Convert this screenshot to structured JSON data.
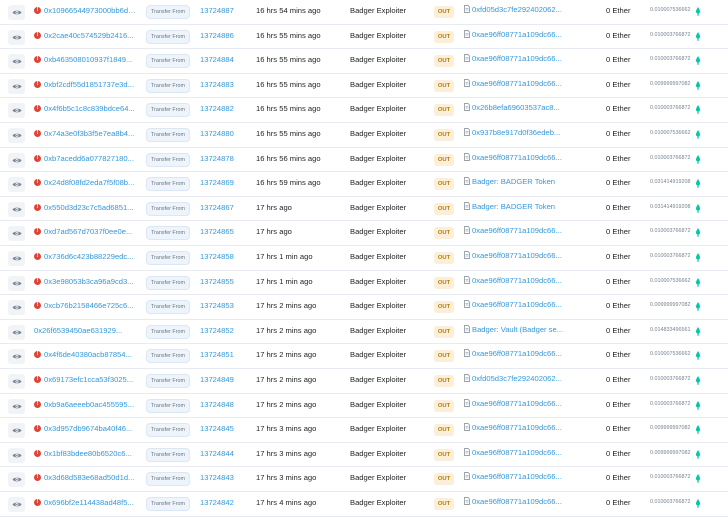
{
  "colors": {
    "link": "#3498db",
    "error": "#de4437",
    "out_bg": "#fcefd9",
    "out_text": "#b47d00",
    "gas_green": "#00c9a7"
  },
  "icons": {
    "view": "eye-icon",
    "error": "exclamation-circle-icon",
    "contract": "file-contract-icon",
    "gas": "gas-drop-icon"
  },
  "rows": [
    {
      "error": true,
      "hash": "0x10966544973000bb6d38...",
      "method": "Transfer From",
      "block": "13724887",
      "age": "16 hrs 54 mins ago",
      "from": "Badger Exploiter",
      "dir": "OUT",
      "to": "0xfd05d3c7fe292402062...",
      "to_contract": true,
      "value": "0 Ether",
      "fee": "0.010007536662"
    },
    {
      "error": true,
      "hash": "0x2cae40c574529b2416...",
      "method": "Transfer From",
      "block": "13724886",
      "age": "16 hrs 55 mins ago",
      "from": "Badger Exploiter",
      "dir": "OUT",
      "to": "0xae96ff08771a109dc66...",
      "to_contract": true,
      "value": "0 Ether",
      "fee": "0.010003766872"
    },
    {
      "error": true,
      "hash": "0xb463508010937f1849...",
      "method": "Transfer From",
      "block": "13724884",
      "age": "16 hrs 55 mins ago",
      "from": "Badger Exploiter",
      "dir": "OUT",
      "to": "0xae96ff08771a109dc66...",
      "to_contract": true,
      "value": "0 Ether",
      "fee": "0.010003766872"
    },
    {
      "error": true,
      "hash": "0xbf2cdf55d1851737e3d...",
      "method": "Transfer From",
      "block": "13724883",
      "age": "16 hrs 55 mins ago",
      "from": "Badger Exploiter",
      "dir": "OUT",
      "to": "0xae96ff08771a109dc66...",
      "to_contract": true,
      "value": "0 Ether",
      "fee": "0.009999997082"
    },
    {
      "error": true,
      "hash": "0x4f6b5c1c8c839bdce64...",
      "method": "Transfer From",
      "block": "13724882",
      "age": "16 hrs 55 mins ago",
      "from": "Badger Exploiter",
      "dir": "OUT",
      "to": "0x26b8efa69603537ac8...",
      "to_contract": true,
      "value": "0 Ether",
      "fee": "0.010003766872"
    },
    {
      "error": true,
      "hash": "0x74a3e0f3b3f5e7ea8b4...",
      "method": "Transfer From",
      "block": "13724880",
      "age": "16 hrs 55 mins ago",
      "from": "Badger Exploiter",
      "dir": "OUT",
      "to": "0x937b8e917d0f36edeb...",
      "to_contract": true,
      "value": "0 Ether",
      "fee": "0.010007536662"
    },
    {
      "error": true,
      "hash": "0xb7acedd6a077827180...",
      "method": "Transfer From",
      "block": "13724878",
      "age": "16 hrs 56 mins ago",
      "from": "Badger Exploiter",
      "dir": "OUT",
      "to": "0xae96ff08771a109dc66...",
      "to_contract": true,
      "value": "0 Ether",
      "fee": "0.010003766872"
    },
    {
      "error": true,
      "hash": "0x24d8f08fd2eda7f5f08b...",
      "method": "Transfer From",
      "block": "13724869",
      "age": "16 hrs 59 mins ago",
      "from": "Badger Exploiter",
      "dir": "OUT",
      "to": "Badger: BADGER Token",
      "to_contract": true,
      "value": "0 Ether",
      "fee": "0.031414919208"
    },
    {
      "error": true,
      "hash": "0x550d3d23c7c5ad6851...",
      "method": "Transfer From",
      "block": "13724867",
      "age": "17 hrs ago",
      "from": "Badger Exploiter",
      "dir": "OUT",
      "to": "Badger: BADGER Token",
      "to_contract": true,
      "value": "0 Ether",
      "fee": "0.031414919208"
    },
    {
      "error": true,
      "hash": "0xd7ad567d7037f0ee0e...",
      "method": "Transfer From",
      "block": "13724865",
      "age": "17 hrs ago",
      "from": "Badger Exploiter",
      "dir": "OUT",
      "to": "0xae96ff08771a109dc66...",
      "to_contract": true,
      "value": "0 Ether",
      "fee": "0.010003766872"
    },
    {
      "error": true,
      "hash": "0x736d6c423b88229edc...",
      "method": "Transfer From",
      "block": "13724858",
      "age": "17 hrs 1 min ago",
      "from": "Badger Exploiter",
      "dir": "OUT",
      "to": "0xae96ff08771a109dc66...",
      "to_contract": true,
      "value": "0 Ether",
      "fee": "0.010003766872"
    },
    {
      "error": true,
      "hash": "0x3e98053b3ca96a9cd3...",
      "method": "Transfer From",
      "block": "13724855",
      "age": "17 hrs 1 min ago",
      "from": "Badger Exploiter",
      "dir": "OUT",
      "to": "0xae96ff08771a109dc66...",
      "to_contract": true,
      "value": "0 Ether",
      "fee": "0.010007536662"
    },
    {
      "error": true,
      "hash": "0xcb76b2158466e725c6...",
      "method": "Transfer From",
      "block": "13724853",
      "age": "17 hrs 2 mins ago",
      "from": "Badger Exploiter",
      "dir": "OUT",
      "to": "0xae96ff08771a109dc66...",
      "to_contract": true,
      "value": "0 Ether",
      "fee": "0.009999997082"
    },
    {
      "error": false,
      "hash": "0x26f6539450ae631929...",
      "method": "Transfer From",
      "block": "13724852",
      "age": "17 hrs 2 mins ago",
      "from": "Badger Exploiter",
      "dir": "OUT",
      "to": "Badger: Vault (Badger se...",
      "to_contract": true,
      "value": "0 Ether",
      "fee": "0.014833496561"
    },
    {
      "error": true,
      "hash": "0x4f6de40380acb87854...",
      "method": "Transfer From",
      "block": "13724851",
      "age": "17 hrs 2 mins ago",
      "from": "Badger Exploiter",
      "dir": "OUT",
      "to": "0xae96ff08771a109dc66...",
      "to_contract": true,
      "value": "0 Ether",
      "fee": "0.010007536662"
    },
    {
      "error": true,
      "hash": "0x69173efc1cca53f3025...",
      "method": "Transfer From",
      "block": "13724849",
      "age": "17 hrs 2 mins ago",
      "from": "Badger Exploiter",
      "dir": "OUT",
      "to": "0xfd05d3c7fe292402062...",
      "to_contract": true,
      "value": "0 Ether",
      "fee": "0.010003766872"
    },
    {
      "error": true,
      "hash": "0xb9a6aeeeb0ac455595...",
      "method": "Transfer From",
      "block": "13724848",
      "age": "17 hrs 2 mins ago",
      "from": "Badger Exploiter",
      "dir": "OUT",
      "to": "0xae96ff08771a109dc66...",
      "to_contract": true,
      "value": "0 Ether",
      "fee": "0.010003766872"
    },
    {
      "error": true,
      "hash": "0x3d957db9674ba40f46...",
      "method": "Transfer From",
      "block": "13724845",
      "age": "17 hrs 3 mins ago",
      "from": "Badger Exploiter",
      "dir": "OUT",
      "to": "0xae96ff08771a109dc66...",
      "to_contract": true,
      "value": "0 Ether",
      "fee": "0.009999997082"
    },
    {
      "error": true,
      "hash": "0x1bf83bdee80b6520c6...",
      "method": "Transfer From",
      "block": "13724844",
      "age": "17 hrs 3 mins ago",
      "from": "Badger Exploiter",
      "dir": "OUT",
      "to": "0xae96ff08771a109dc66...",
      "to_contract": true,
      "value": "0 Ether",
      "fee": "0.009999997082"
    },
    {
      "error": true,
      "hash": "0x3d68d583e68ad50d1d...",
      "method": "Transfer From",
      "block": "13724843",
      "age": "17 hrs 3 mins ago",
      "from": "Badger Exploiter",
      "dir": "OUT",
      "to": "0xae96ff08771a109dc66...",
      "to_contract": true,
      "value": "0 Ether",
      "fee": "0.010003766872"
    },
    {
      "error": true,
      "hash": "0x696bf2e114438ad48f5...",
      "method": "Transfer From",
      "block": "13724842",
      "age": "17 hrs 4 mins ago",
      "from": "Badger Exploiter",
      "dir": "OUT",
      "to": "0xae96ff08771a109dc66...",
      "to_contract": true,
      "value": "0 Ether",
      "fee": "0.010003766872"
    }
  ]
}
